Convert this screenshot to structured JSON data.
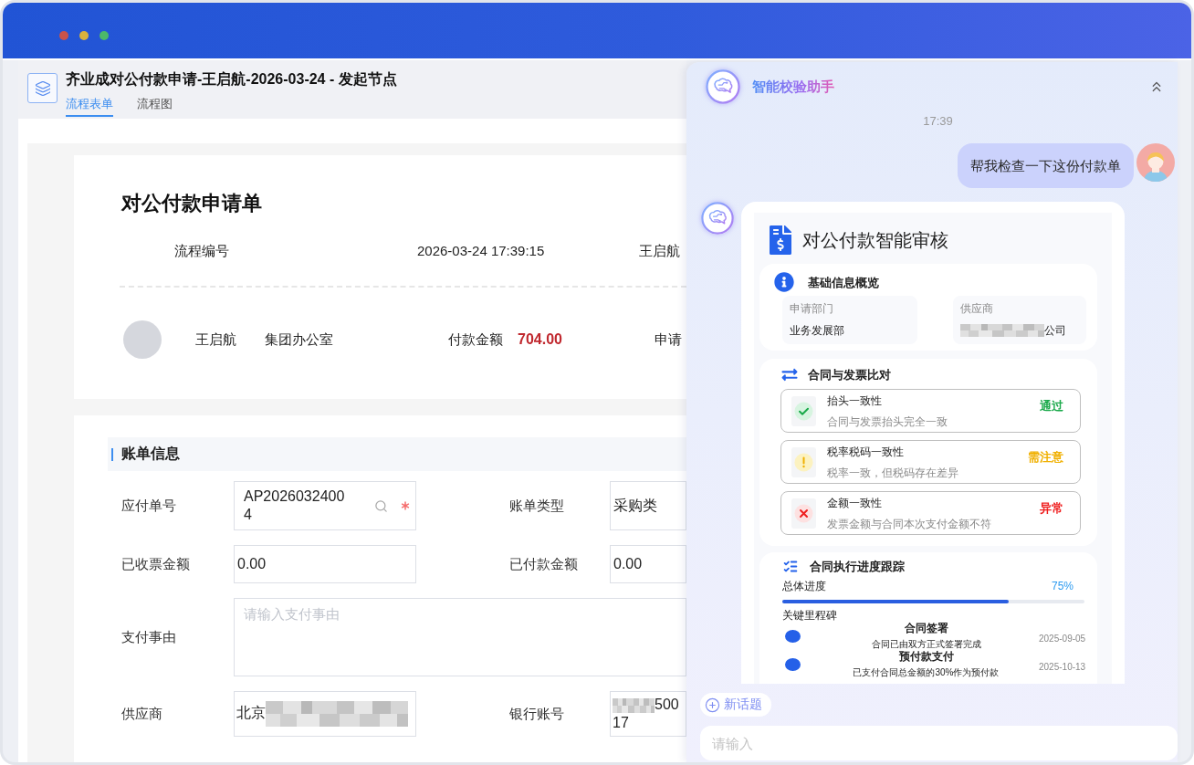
{
  "window": {
    "title": "齐业成对公付款申请-王启航-2026-03-24 - 发起节点",
    "tabs": [
      {
        "label": "流程表单",
        "selected": true
      },
      {
        "label": "流程图",
        "selected": false
      }
    ]
  },
  "form": {
    "title": "对公付款申请单",
    "meta": {
      "number_label": "流程编号",
      "created_at": "2026-03-24 17:39:15",
      "initiator": "王启航"
    },
    "applicant": {
      "name": "王启航",
      "department": "集团办公室",
      "amount_label": "付款金额",
      "amount": "704.00",
      "field_5": "申请"
    },
    "section": {
      "title": "账单信息",
      "rows": [
        {
          "fields": [
            {
              "label": "应付单号",
              "kind": "lookup",
              "value": "AP20260324004",
              "required": true
            },
            {
              "label": "账单类型",
              "kind": "text",
              "value": "采购类"
            }
          ]
        },
        {
          "fields": [
            {
              "label": "已收票金额",
              "kind": "text",
              "value": "0.00"
            },
            {
              "label": "已付款金额",
              "kind": "text",
              "value": "0.00"
            }
          ]
        },
        {
          "fields": [
            {
              "label": "支付事由",
              "kind": "textarea",
              "placeholder": "请输入支付事由"
            }
          ]
        },
        {
          "fields": [
            {
              "label": "供应商",
              "kind": "text",
              "value": "北京",
              "redacted_after": true
            },
            {
              "label": "银行账号",
              "kind": "text",
              "value": "50017",
              "redacted_before": true
            }
          ]
        }
      ]
    }
  },
  "assistant": {
    "title": "智能校验助手",
    "messages": [
      {
        "kind": "time",
        "text": "17:39"
      },
      {
        "kind": "user",
        "text": "帮我检查一下这份付款单"
      },
      {
        "kind": "report",
        "title": "对公付款智能审核",
        "overview": {
          "title": "基础信息概览",
          "items": [
            {
              "label": "申请部门",
              "value": "业务发展部"
            },
            {
              "label": "供应商",
              "value": "公司",
              "redacted_before": true
            }
          ]
        },
        "comparison": {
          "title": "合同与发票比对",
          "checks": [
            {
              "title": "抬头一致性",
              "detail": "合同与发票抬头完全一致",
              "result": "通过",
              "kind": "pass"
            },
            {
              "title": "税率税码一致性",
              "detail": "税率一致，但税码存在差异",
              "result": "需注意",
              "kind": "warning"
            },
            {
              "title": "金额一致性",
              "detail": "发票金额与合同本次支付金额不符",
              "result": "异常",
              "kind": "error"
            }
          ]
        },
        "progress": {
          "title": "合同执行进度跟踪",
          "label": "总体进度",
          "reading": "75%",
          "level": 0.75,
          "milestones_title": "关键里程碑",
          "milestones": [
            {
              "title": "合同签署",
              "detail": "合同已由双方正式签署完成",
              "date": "2025-09-05"
            },
            {
              "title": "预付款支付",
              "detail": "已支付合同总金额的30%作为预付款",
              "date": "2025-10-13"
            }
          ]
        }
      }
    ],
    "new_topic": "新话题",
    "input": {
      "placeholder": "请输入"
    }
  }
}
